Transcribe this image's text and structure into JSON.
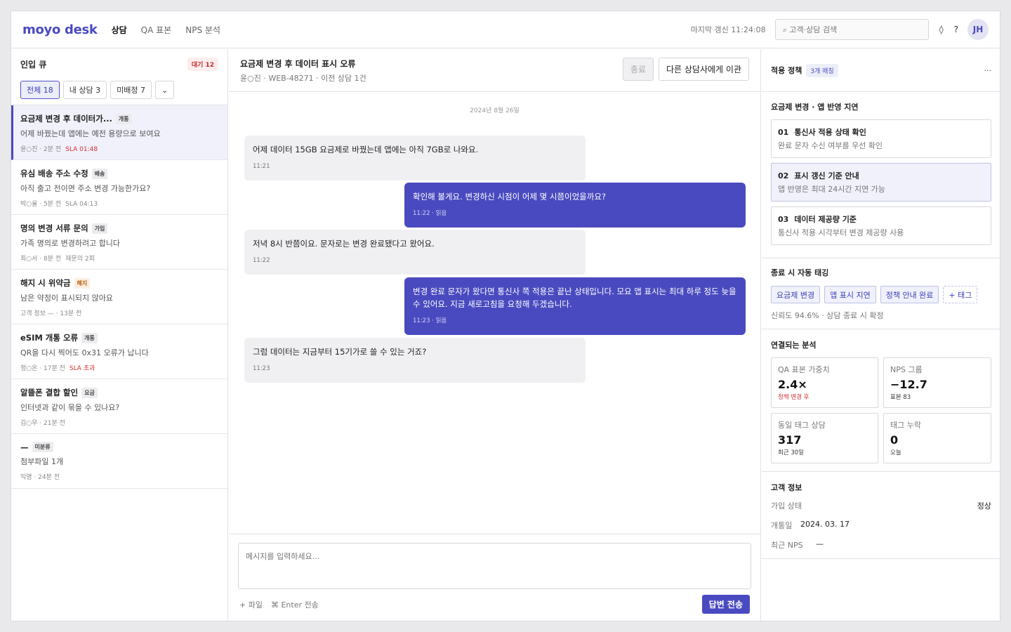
{
  "app": {
    "logo": "moyo desk"
  },
  "nav": {
    "items": [
      "상담",
      "QA 표본",
      "NPS 분석"
    ]
  },
  "topbar": {
    "last_update": "마지막 갱신 11:24:08",
    "search_placeholder": "⌕ 고객·상담 검색",
    "bell": "◊",
    "help": "?",
    "avatar": "JH"
  },
  "queue": {
    "title": "인입 큐",
    "waiting": "대기 12",
    "filters": [
      "전체 18",
      "내 상담 3",
      "미배정 7"
    ],
    "more": "⌄",
    "items": [
      {
        "title": "요금제 변경 후 데이터가...",
        "tag": "개통",
        "preview": "어제 바꿨는데 앱에는 예전 용량으로 보여요",
        "meta": "윤○진 · 2분 전",
        "sla": "SLA 01:48"
      },
      {
        "title": "유심 배송 주소 수정",
        "tag": "배송",
        "preview": "아직 출고 전이면 주소 변경 가능한가요?",
        "meta": "박○율 · 5분 전",
        "extra": "SLA 04:13"
      },
      {
        "title": "명의 변경 서류 문의",
        "tag": "가입",
        "preview": "가족 명의로 변경하려고 합니다",
        "meta": "최○서 · 8분 전",
        "extra": "재문의 2회"
      },
      {
        "title": "해지 시 위약금",
        "tag": "해지",
        "preview": "남은 약정이 표시되지 않아요",
        "meta": "고객 정보 — · 13분 전"
      },
      {
        "title": "eSIM 개통 오류",
        "tag": "개통",
        "preview": "QR을 다시 찍어도 0x31 오류가 납니다",
        "meta": "정○온 · 17분 전",
        "sla": "SLA 초과"
      },
      {
        "title": "알뜰폰 결합 할인",
        "tag": "요금",
        "preview": "인터넷과 같이 묶을 수 있나요?",
        "meta": "김○우 · 21분 전"
      },
      {
        "title": "—",
        "tag": "미분류",
        "preview": "첨부파일 1개",
        "meta": "익명 · 24분 전"
      }
    ]
  },
  "chat": {
    "title": "요금제 변경 후 데이터 표시 오류",
    "subtitle": "윤○진 · WEB-48271 · 이전 상담 1건",
    "end_btn": "종료",
    "transfer_btn": "다른 상담사에게 이관",
    "date": "2024년 8월 26일",
    "messages": [
      {
        "text": "어제 데이터 15GB 요금제로 바꿨는데 앱에는 아직 7GB로 나와요.",
        "time": "11:21"
      },
      {
        "text": "확인해 볼게요. 변경하신 시점이 어제 몇 시쯤이었을까요?",
        "time": "11:22 · 읽음"
      },
      {
        "text": "저녁 8시 반쯤이요. 문자로는 변경 완료됐다고 왔어요.",
        "time": "11:22"
      },
      {
        "text": "변경 완료 문자가 왔다면 통신사 쪽 적용은 끝난 상태입니다. 모요 앱 표시는 최대 하루 정도 늦을 수 있어요. 지금 새로고침을 요청해 두겠습니다.",
        "time": "11:23 · 읽음"
      },
      {
        "text": "그럼 데이터는 지금부터 15기가로 쓸 수 있는 거죠?",
        "time": "11:23"
      }
    ],
    "input_placeholder": "메시지를 입력하세요...",
    "file": "+ 파일",
    "hint": "⌘ Enter 전송",
    "send": "답변 전송"
  },
  "policy": {
    "title": "적용 정책",
    "match": "3개 매칭",
    "more": "···",
    "section": "요금제 변경 · 앱 반영 지연",
    "steps": [
      {
        "num": "01",
        "title": "통신사 적용 상태 확인",
        "desc": "완료 문자 수신 여부를 우선 확인"
      },
      {
        "num": "02",
        "title": "표시 갱신 기준 안내",
        "desc": "앱 반영은 최대 24시간 지연 가능"
      },
      {
        "num": "03",
        "title": "데이터 제공량 기준",
        "desc": "통신사 적용 시각부터 변경 제공량 사용"
      }
    ]
  },
  "autotag": {
    "title": "종료 시 자동 태깅",
    "tags": [
      "요금제 변경",
      "앱 표시 지연",
      "정책 안내 완료"
    ],
    "add": "+ 태그",
    "note": "신뢰도 94.6% · 상담 종료 시 확정"
  },
  "analysis": {
    "title": "연결되는 분석",
    "cards": [
      {
        "label": "QA 표본 가중치",
        "value": "2.4×",
        "note": "정책 변경 후"
      },
      {
        "label": "NPS 그룹",
        "value": "−12.7",
        "note": "표본 83"
      },
      {
        "label": "동일 태그 상담",
        "value": "317",
        "note": "최근 30일"
      },
      {
        "label": "태그 누락",
        "value": "0",
        "note": "오늘"
      }
    ]
  },
  "customer": {
    "title": "고객 정보",
    "rows": [
      {
        "key": "가입 상태",
        "value": "정상"
      },
      {
        "key": "개통일",
        "value": "2024. 03. 17"
      },
      {
        "key": "최근 NPS",
        "value": "—"
      }
    ]
  },
  "colors": {
    "accent": "#4a4ac0",
    "danger": "#d32f2f"
  }
}
